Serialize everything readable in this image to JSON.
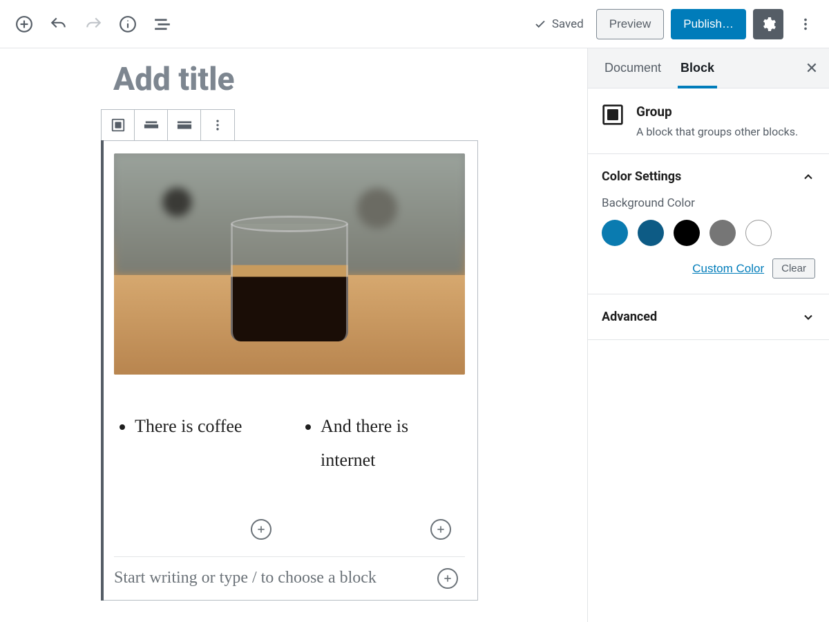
{
  "topbar": {
    "saved_label": "Saved",
    "preview_label": "Preview",
    "publish_label": "Publish…"
  },
  "editor": {
    "title_placeholder": "Add title",
    "columns": {
      "left_item": "There is coffee",
      "right_item": "And there is internet"
    },
    "prompt": "Start writing or type / to choose a block"
  },
  "sidebar": {
    "tabs": {
      "document": "Document",
      "block": "Block"
    },
    "group": {
      "title": "Group",
      "description": "A block that groups other blocks."
    },
    "color_settings": {
      "heading": "Color Settings",
      "bg_label": "Background Color",
      "swatches": [
        "#0a7bb0",
        "#0d5b85",
        "#000000",
        "#767676",
        "#ffffff"
      ],
      "custom_label": "Custom Color",
      "clear_label": "Clear"
    },
    "advanced": {
      "heading": "Advanced"
    }
  }
}
